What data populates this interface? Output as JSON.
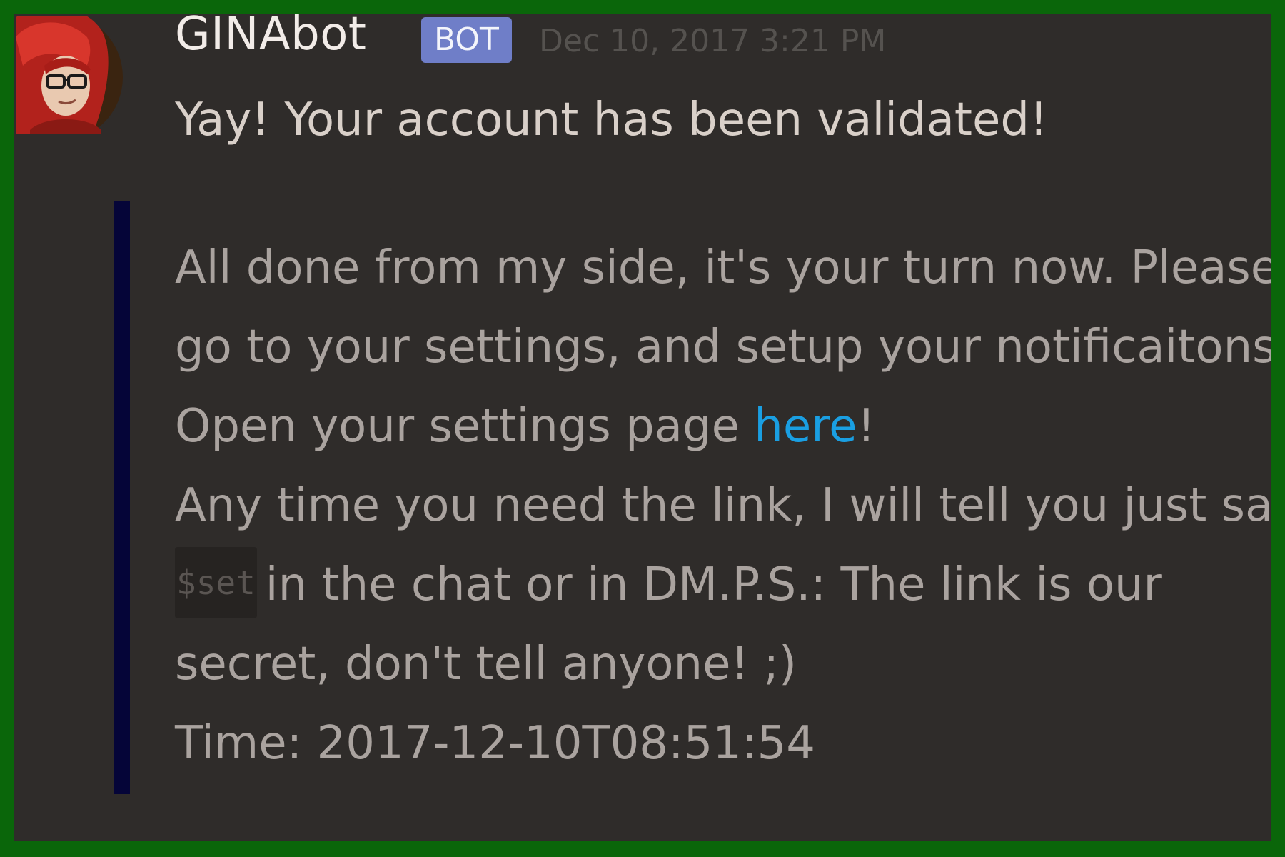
{
  "message": {
    "author": "GINAbot",
    "badge": "BOT",
    "timestamp": "Dec 10, 2017 3:21 PM",
    "text": "Yay! Your account has been validated!"
  },
  "embed": {
    "accent_color": "#050538",
    "line1": "All done from my side, it's your turn now. Please",
    "line2": "go to your settings, and setup your notificaitons",
    "line3_before": "Open your settings page ",
    "line3_link": "here",
    "line3_after": "!",
    "line4": "Any time you need the link, I will tell you just say",
    "command": "$set",
    "line5_after": "in the chat or in DM.P.S.: The link is our",
    "line6": "secret, don't tell anyone! ;)",
    "line7": "Time: 2017-12-10T08:51:54"
  },
  "colors": {
    "frame_border": "#0a660a",
    "background": "#2f2c2a",
    "badge": "#6f7ec8",
    "link": "#1a9fe2"
  },
  "icons": {
    "avatar": "red-haired-woman-with-glasses-avatar"
  }
}
